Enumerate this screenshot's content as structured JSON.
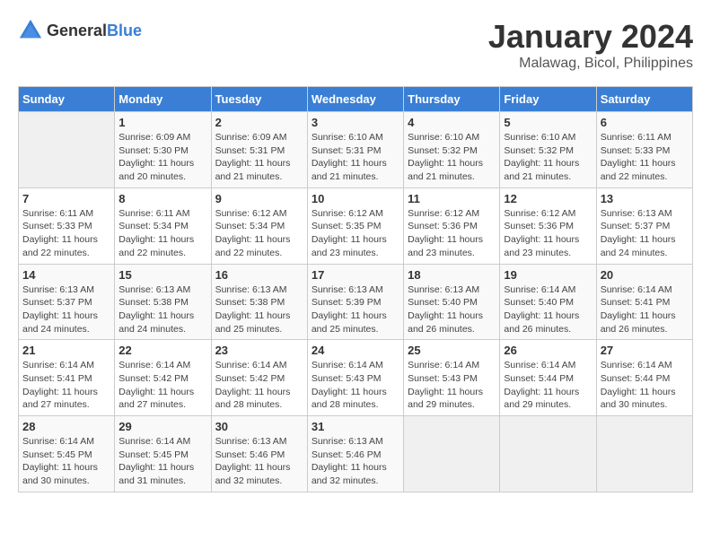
{
  "header": {
    "logo_general": "General",
    "logo_blue": "Blue",
    "title": "January 2024",
    "subtitle": "Malawag, Bicol, Philippines"
  },
  "weekdays": [
    "Sunday",
    "Monday",
    "Tuesday",
    "Wednesday",
    "Thursday",
    "Friday",
    "Saturday"
  ],
  "weeks": [
    [
      {
        "day": "",
        "sunrise": "",
        "sunset": "",
        "daylight": ""
      },
      {
        "day": "1",
        "sunrise": "Sunrise: 6:09 AM",
        "sunset": "Sunset: 5:30 PM",
        "daylight": "Daylight: 11 hours and 20 minutes."
      },
      {
        "day": "2",
        "sunrise": "Sunrise: 6:09 AM",
        "sunset": "Sunset: 5:31 PM",
        "daylight": "Daylight: 11 hours and 21 minutes."
      },
      {
        "day": "3",
        "sunrise": "Sunrise: 6:10 AM",
        "sunset": "Sunset: 5:31 PM",
        "daylight": "Daylight: 11 hours and 21 minutes."
      },
      {
        "day": "4",
        "sunrise": "Sunrise: 6:10 AM",
        "sunset": "Sunset: 5:32 PM",
        "daylight": "Daylight: 11 hours and 21 minutes."
      },
      {
        "day": "5",
        "sunrise": "Sunrise: 6:10 AM",
        "sunset": "Sunset: 5:32 PM",
        "daylight": "Daylight: 11 hours and 21 minutes."
      },
      {
        "day": "6",
        "sunrise": "Sunrise: 6:11 AM",
        "sunset": "Sunset: 5:33 PM",
        "daylight": "Daylight: 11 hours and 22 minutes."
      }
    ],
    [
      {
        "day": "7",
        "sunrise": "Sunrise: 6:11 AM",
        "sunset": "Sunset: 5:33 PM",
        "daylight": "Daylight: 11 hours and 22 minutes."
      },
      {
        "day": "8",
        "sunrise": "Sunrise: 6:11 AM",
        "sunset": "Sunset: 5:34 PM",
        "daylight": "Daylight: 11 hours and 22 minutes."
      },
      {
        "day": "9",
        "sunrise": "Sunrise: 6:12 AM",
        "sunset": "Sunset: 5:34 PM",
        "daylight": "Daylight: 11 hours and 22 minutes."
      },
      {
        "day": "10",
        "sunrise": "Sunrise: 6:12 AM",
        "sunset": "Sunset: 5:35 PM",
        "daylight": "Daylight: 11 hours and 23 minutes."
      },
      {
        "day": "11",
        "sunrise": "Sunrise: 6:12 AM",
        "sunset": "Sunset: 5:36 PM",
        "daylight": "Daylight: 11 hours and 23 minutes."
      },
      {
        "day": "12",
        "sunrise": "Sunrise: 6:12 AM",
        "sunset": "Sunset: 5:36 PM",
        "daylight": "Daylight: 11 hours and 23 minutes."
      },
      {
        "day": "13",
        "sunrise": "Sunrise: 6:13 AM",
        "sunset": "Sunset: 5:37 PM",
        "daylight": "Daylight: 11 hours and 24 minutes."
      }
    ],
    [
      {
        "day": "14",
        "sunrise": "Sunrise: 6:13 AM",
        "sunset": "Sunset: 5:37 PM",
        "daylight": "Daylight: 11 hours and 24 minutes."
      },
      {
        "day": "15",
        "sunrise": "Sunrise: 6:13 AM",
        "sunset": "Sunset: 5:38 PM",
        "daylight": "Daylight: 11 hours and 24 minutes."
      },
      {
        "day": "16",
        "sunrise": "Sunrise: 6:13 AM",
        "sunset": "Sunset: 5:38 PM",
        "daylight": "Daylight: 11 hours and 25 minutes."
      },
      {
        "day": "17",
        "sunrise": "Sunrise: 6:13 AM",
        "sunset": "Sunset: 5:39 PM",
        "daylight": "Daylight: 11 hours and 25 minutes."
      },
      {
        "day": "18",
        "sunrise": "Sunrise: 6:13 AM",
        "sunset": "Sunset: 5:40 PM",
        "daylight": "Daylight: 11 hours and 26 minutes."
      },
      {
        "day": "19",
        "sunrise": "Sunrise: 6:14 AM",
        "sunset": "Sunset: 5:40 PM",
        "daylight": "Daylight: 11 hours and 26 minutes."
      },
      {
        "day": "20",
        "sunrise": "Sunrise: 6:14 AM",
        "sunset": "Sunset: 5:41 PM",
        "daylight": "Daylight: 11 hours and 26 minutes."
      }
    ],
    [
      {
        "day": "21",
        "sunrise": "Sunrise: 6:14 AM",
        "sunset": "Sunset: 5:41 PM",
        "daylight": "Daylight: 11 hours and 27 minutes."
      },
      {
        "day": "22",
        "sunrise": "Sunrise: 6:14 AM",
        "sunset": "Sunset: 5:42 PM",
        "daylight": "Daylight: 11 hours and 27 minutes."
      },
      {
        "day": "23",
        "sunrise": "Sunrise: 6:14 AM",
        "sunset": "Sunset: 5:42 PM",
        "daylight": "Daylight: 11 hours and 28 minutes."
      },
      {
        "day": "24",
        "sunrise": "Sunrise: 6:14 AM",
        "sunset": "Sunset: 5:43 PM",
        "daylight": "Daylight: 11 hours and 28 minutes."
      },
      {
        "day": "25",
        "sunrise": "Sunrise: 6:14 AM",
        "sunset": "Sunset: 5:43 PM",
        "daylight": "Daylight: 11 hours and 29 minutes."
      },
      {
        "day": "26",
        "sunrise": "Sunrise: 6:14 AM",
        "sunset": "Sunset: 5:44 PM",
        "daylight": "Daylight: 11 hours and 29 minutes."
      },
      {
        "day": "27",
        "sunrise": "Sunrise: 6:14 AM",
        "sunset": "Sunset: 5:44 PM",
        "daylight": "Daylight: 11 hours and 30 minutes."
      }
    ],
    [
      {
        "day": "28",
        "sunrise": "Sunrise: 6:14 AM",
        "sunset": "Sunset: 5:45 PM",
        "daylight": "Daylight: 11 hours and 30 minutes."
      },
      {
        "day": "29",
        "sunrise": "Sunrise: 6:14 AM",
        "sunset": "Sunset: 5:45 PM",
        "daylight": "Daylight: 11 hours and 31 minutes."
      },
      {
        "day": "30",
        "sunrise": "Sunrise: 6:13 AM",
        "sunset": "Sunset: 5:46 PM",
        "daylight": "Daylight: 11 hours and 32 minutes."
      },
      {
        "day": "31",
        "sunrise": "Sunrise: 6:13 AM",
        "sunset": "Sunset: 5:46 PM",
        "daylight": "Daylight: 11 hours and 32 minutes."
      },
      {
        "day": "",
        "sunrise": "",
        "sunset": "",
        "daylight": ""
      },
      {
        "day": "",
        "sunrise": "",
        "sunset": "",
        "daylight": ""
      },
      {
        "day": "",
        "sunrise": "",
        "sunset": "",
        "daylight": ""
      }
    ]
  ]
}
